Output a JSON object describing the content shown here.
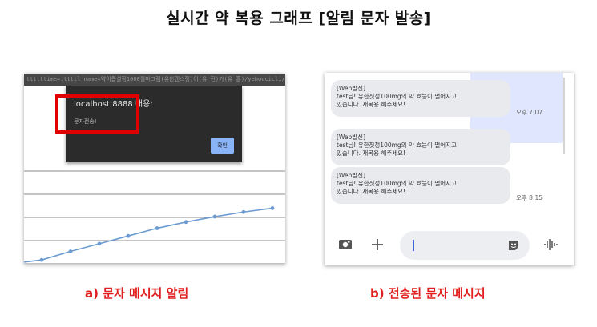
{
  "page": {
    "title": "실시간 약 복용 그래프 [알림 문자 발송]"
  },
  "panel_a": {
    "url_text": "ttttttime=.ttttl_name=약이름설정1000월마그램(유한캔스정)이(유 진)가(유 흥)/yehoccicli/enogmchapefs)",
    "dialog": {
      "title": "localhost:8888 내용:",
      "message": "문자전송!",
      "ok_label": "확인"
    },
    "caption": "a) 문자 메시지 알림"
  },
  "chart_data": {
    "type": "line",
    "title": "",
    "xlabel": "",
    "ylabel": "",
    "grid": true,
    "series": [
      {
        "name": "",
        "values": [
          0.5,
          1.6,
          2.6,
          3.6,
          4.6,
          5.4,
          6.1,
          6.7,
          7.2
        ]
      }
    ],
    "ylim": [
      0,
      12
    ],
    "accent": "#6b9bd1"
  },
  "panel_b": {
    "messages": [
      {
        "sender": "[Web발신]",
        "line1": "test님! 유한짓정100mg의 약 효능이 떨어지고",
        "line2": "있습니다. 재복용 해주세요!",
        "time": "오후 7:07"
      },
      {
        "sender": "[Web발신]",
        "line1": "test님! 유한짓정100mg의 약 효능이 떨어지고",
        "line2": "있습니다. 재복용 해주세요!",
        "time": ""
      },
      {
        "sender": "[Web발신]",
        "line1": "test님! 유한짓정100mg의 약 효능이 떨어지고",
        "line2": "있습니다. 재복용 해주세요!",
        "time": "오후 8:15"
      }
    ],
    "composer": {
      "icons": [
        "gallery-icon",
        "plus-icon",
        "sticker-icon",
        "voice-icon"
      ]
    },
    "caption": "b) 전송된 문자 메시지"
  }
}
